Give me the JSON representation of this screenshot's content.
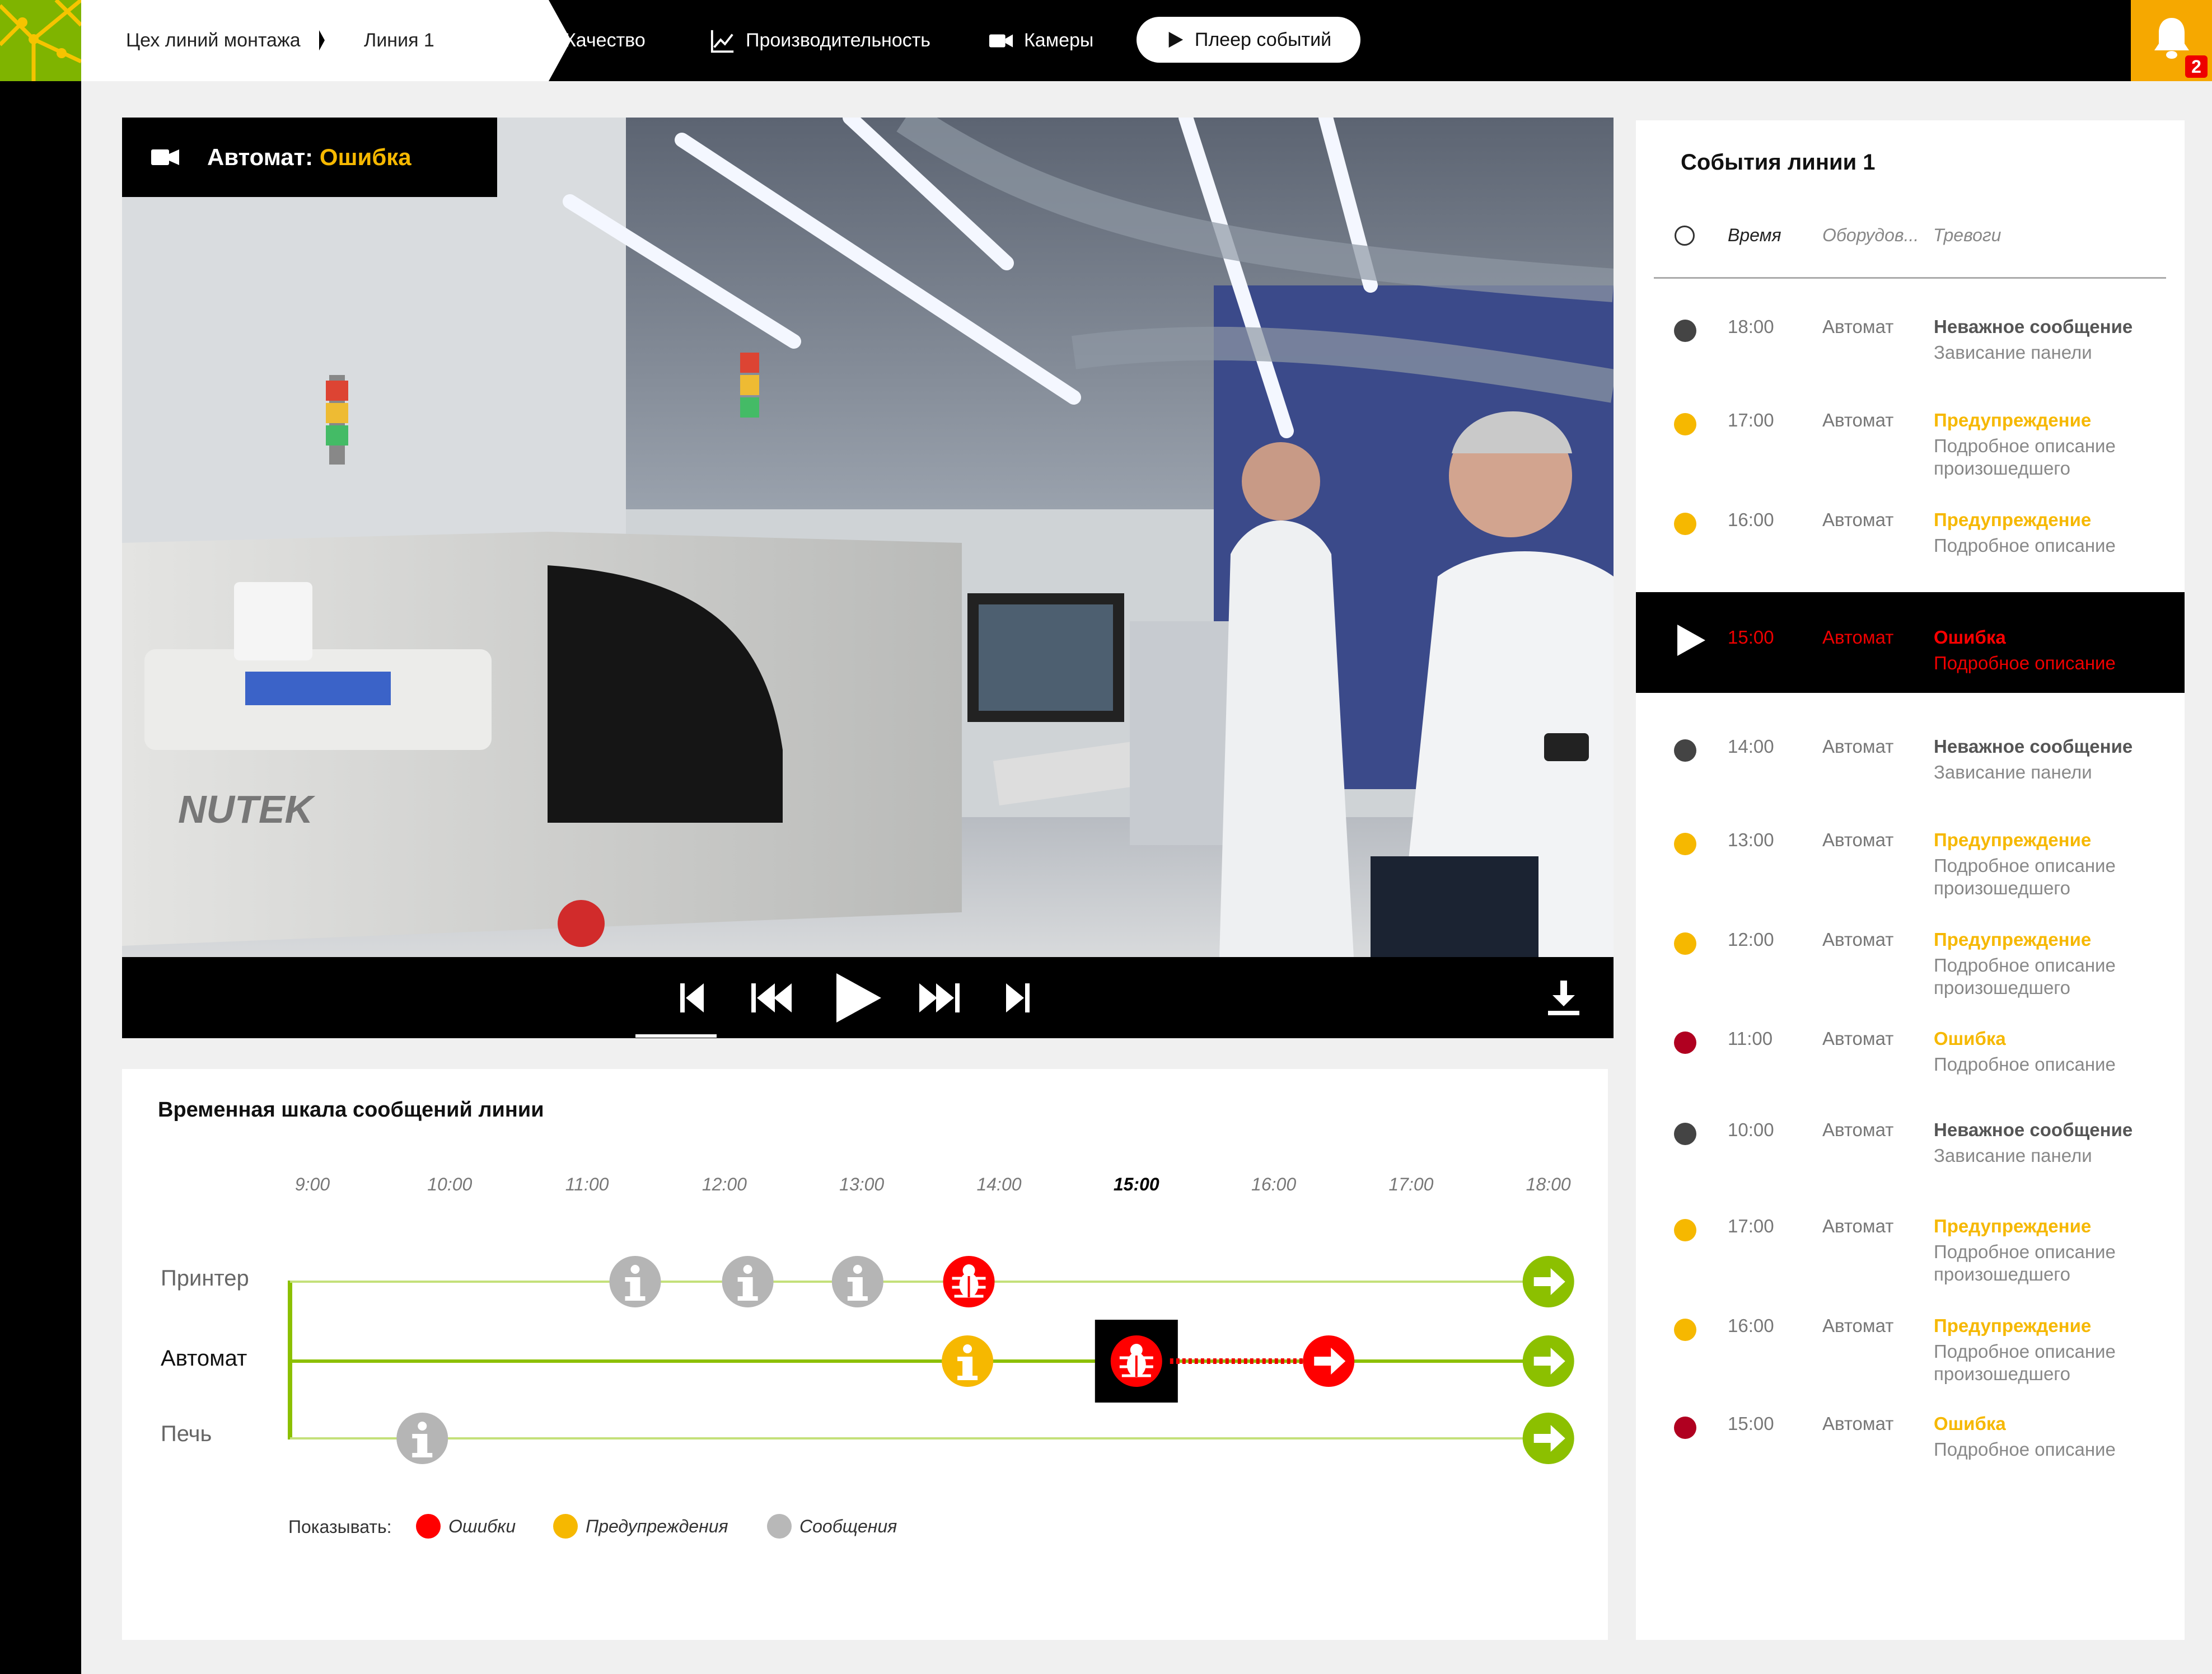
{
  "breadcrumbs": [
    "Цех линий монтажа",
    "Линия 1"
  ],
  "nav": {
    "quality": "Качество",
    "performance": "Производительность",
    "cameras": "Камеры",
    "player": "Плеер событий"
  },
  "alarm": {
    "count": "2",
    "icon": "bell-icon"
  },
  "video": {
    "source_label": "Автомат:",
    "status_label": "Ошибка",
    "status_color": "#f6b800",
    "progress": 0.35
  },
  "timeline": {
    "title": "Временная шкала сообщений линии",
    "ticks": [
      "9:00",
      "10:00",
      "11:00",
      "12:00",
      "13:00",
      "14:00",
      "15:00",
      "16:00",
      "17:00",
      "18:00"
    ],
    "active_tick": "15:00",
    "rows": [
      {
        "label": "Принтер",
        "events": [
          {
            "time": 11.35,
            "kind": "message"
          },
          {
            "time": 12.17,
            "kind": "message"
          },
          {
            "time": 12.97,
            "kind": "message"
          },
          {
            "time": 13.78,
            "kind": "error"
          },
          {
            "time": 18.0,
            "kind": "end"
          }
        ]
      },
      {
        "label": "Автомат",
        "events": [
          {
            "time": 13.77,
            "kind": "warning"
          },
          {
            "time": 15.0,
            "kind": "error",
            "selected": true
          },
          {
            "time": 16.4,
            "kind": "error-arrow"
          },
          {
            "time": 18.0,
            "kind": "end"
          }
        ]
      },
      {
        "label": "Печь",
        "events": [
          {
            "time": 9.8,
            "kind": "message"
          },
          {
            "time": 18.0,
            "kind": "end"
          }
        ]
      }
    ],
    "show_label": "Показывать:",
    "legend": [
      {
        "label": "Ошибки",
        "color": "#ff0000"
      },
      {
        "label": "Предупреждения",
        "color": "#f6b800"
      },
      {
        "label": "Сообщения",
        "color": "#b8b8b8"
      }
    ]
  },
  "events_panel": {
    "title": "События линии 1",
    "columns": {
      "time": "Время",
      "equipment": "Оборудов...",
      "alarms": "Тревоги"
    },
    "items": [
      {
        "time": "18:00",
        "equipment": "Автомат",
        "type": "Неважное сообщение",
        "desc": "Зависание панели",
        "dot": "#444444",
        "type_color": "#555555"
      },
      {
        "time": "17:00",
        "equipment": "Автомат",
        "type": "Предупреждение",
        "desc": "Подробное описание произошедшего",
        "dot": "#f6b800",
        "type_color": "#f6b800"
      },
      {
        "time": "16:00",
        "equipment": "Автомат",
        "type": "Предупреждение",
        "desc": "Подробное описание",
        "dot": "#f6b800",
        "type_color": "#f6b800"
      },
      {
        "time": "15:00",
        "equipment": "Автомат",
        "type": "Ошибка",
        "desc": "Подробное описание",
        "dot": "",
        "type_color": "#ff0000",
        "selected": true
      },
      {
        "time": "14:00",
        "equipment": "Автомат",
        "type": "Неважное сообщение",
        "desc": "Зависание панели",
        "dot": "#444444",
        "type_color": "#555555"
      },
      {
        "time": "13:00",
        "equipment": "Автомат",
        "type": "Предупреждение",
        "desc": "Подробное описание произошедшего",
        "dot": "#f6b800",
        "type_color": "#f6b800"
      },
      {
        "time": "12:00",
        "equipment": "Автомат",
        "type": "Предупреждение",
        "desc": "Подробное описание произошедшего",
        "dot": "#f6b800",
        "type_color": "#f6b800"
      },
      {
        "time": "11:00",
        "equipment": "Автомат",
        "type": "Ошибка",
        "desc": "Подробное описание",
        "dot": "#b00020",
        "type_color": "#f6b800"
      },
      {
        "time": "10:00",
        "equipment": "Автомат",
        "type": "Неважное сообщение",
        "desc": "Зависание панели",
        "dot": "#444444",
        "type_color": "#555555"
      },
      {
        "time": "17:00",
        "equipment": "Автомат",
        "type": "Предупреждение",
        "desc": "Подробное описание произошедшего",
        "dot": "#f6b800",
        "type_color": "#f6b800"
      },
      {
        "time": "16:00",
        "equipment": "Автомат",
        "type": "Предупреждение",
        "desc": "Подробное описание произошедшего",
        "dot": "#f6b800",
        "type_color": "#f6b800"
      },
      {
        "time": "15:00",
        "equipment": "Автомат",
        "type": "Ошибка",
        "desc": "Подробное описание",
        "dot": "#b00020",
        "type_color": "#f6b800"
      }
    ]
  }
}
